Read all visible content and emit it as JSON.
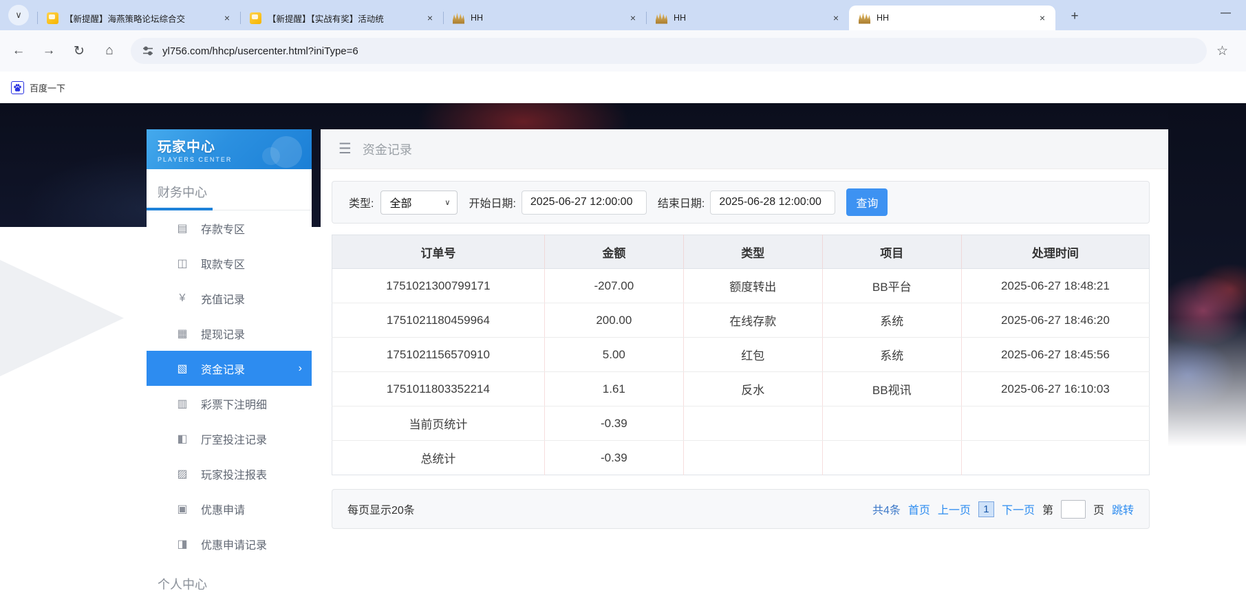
{
  "browser": {
    "tab_search_glyph": "∨",
    "tabs": [
      {
        "title": "【新提醒】海燕策略论坛综合交",
        "icon": "chat-bubble",
        "active": false
      },
      {
        "title": "【新提醒】【实战有奖】活动统",
        "icon": "chat-bubble",
        "active": false
      },
      {
        "title": "HH",
        "icon": "gold-burst",
        "active": false
      },
      {
        "title": "HH",
        "icon": "gold-burst",
        "active": false
      },
      {
        "title": "HH",
        "icon": "gold-burst",
        "active": true
      }
    ],
    "close_glyph": "×",
    "new_tab_glyph": "+",
    "minimize_glyph": "—",
    "nav": {
      "back": "←",
      "forward": "→",
      "reload": "↻",
      "home": "⌂",
      "bookmark_star": "☆"
    },
    "url": "yl756.com/hhcp/usercenter.html?iniType=6",
    "bookmarks": [
      {
        "label": "百度一下",
        "icon": "baidu-paw"
      }
    ]
  },
  "sidebar": {
    "title": "玩家中心",
    "subtitle": "PLAYERS CENTER",
    "finance_section": "财务中心",
    "personal_section": "个人中心",
    "items": [
      {
        "label": "存款专区",
        "icon": "deposit-icon",
        "glyph": "▤",
        "active": false
      },
      {
        "label": "取款专区",
        "icon": "withdraw-icon",
        "glyph": "◫",
        "active": false
      },
      {
        "label": "充值记录",
        "icon": "recharge-record-icon",
        "glyph": "¥",
        "active": false
      },
      {
        "label": "提现记录",
        "icon": "cashout-record-icon",
        "glyph": "▦",
        "active": false
      },
      {
        "label": "资金记录",
        "icon": "fund-record-icon",
        "glyph": "▧",
        "active": true
      },
      {
        "label": "彩票下注明细",
        "icon": "lottery-bet-detail-icon",
        "glyph": "▥",
        "active": false
      },
      {
        "label": "厅室投注记录",
        "icon": "hall-bet-record-icon",
        "glyph": "◧",
        "active": false
      },
      {
        "label": "玩家投注报表",
        "icon": "player-bet-report-icon",
        "glyph": "▨",
        "active": false
      },
      {
        "label": "优惠申请",
        "icon": "promo-apply-icon",
        "glyph": "▣",
        "active": false
      },
      {
        "label": "优惠申请记录",
        "icon": "promo-apply-record-icon",
        "glyph": "◨",
        "active": false
      }
    ],
    "active_chevron": "›"
  },
  "main": {
    "burger_glyph": "☰",
    "title": "资金记录",
    "filter": {
      "type_label": "类型:",
      "type_value": "全部",
      "select_caret": "∨",
      "start_label": "开始日期:",
      "start_value": "2025-06-27 12:00:00",
      "end_label": "结束日期:",
      "end_value": "2025-06-28 12:00:00",
      "search_label": "查询"
    },
    "table": {
      "columns": [
        "订单号",
        "金额",
        "类型",
        "项目",
        "处理时间"
      ],
      "rows": [
        [
          "1751021300799171",
          "-207.00",
          "额度转出",
          "BB平台",
          "2025-06-27 18:48:21"
        ],
        [
          "1751021180459964",
          "200.00",
          "在线存款",
          "系统",
          "2025-06-27 18:46:20"
        ],
        [
          "1751021156570910",
          "5.00",
          "红包",
          "系统",
          "2025-06-27 18:45:56"
        ],
        [
          "1751011803352214",
          "1.61",
          "反水",
          "BB视讯",
          "2025-06-27 16:10:03"
        ],
        [
          "当前页统计",
          "-0.39",
          "",
          "",
          ""
        ],
        [
          "总统计",
          "-0.39",
          "",
          "",
          ""
        ]
      ]
    },
    "pagination": {
      "per_page": "每页显示20条",
      "total": "共4条",
      "first": "首页",
      "prev": "上一页",
      "current": "1",
      "next": "下一页",
      "jump_prefix": "第",
      "jump_suffix": "页",
      "jump": "跳转"
    }
  },
  "colors": {
    "accent_blue": "#2d8cf0",
    "sidebar_header_gradient_top": "#45aaed",
    "sidebar_header_gradient_bottom": "#1b7fd6",
    "link_blue": "#2d8cf0",
    "table_header_bg": "#eef0f4",
    "table_vertical_divider": "#f6dedd",
    "chrome_tabstrip_bg": "#cddcf5",
    "search_button_bg": "#3d92f2"
  }
}
